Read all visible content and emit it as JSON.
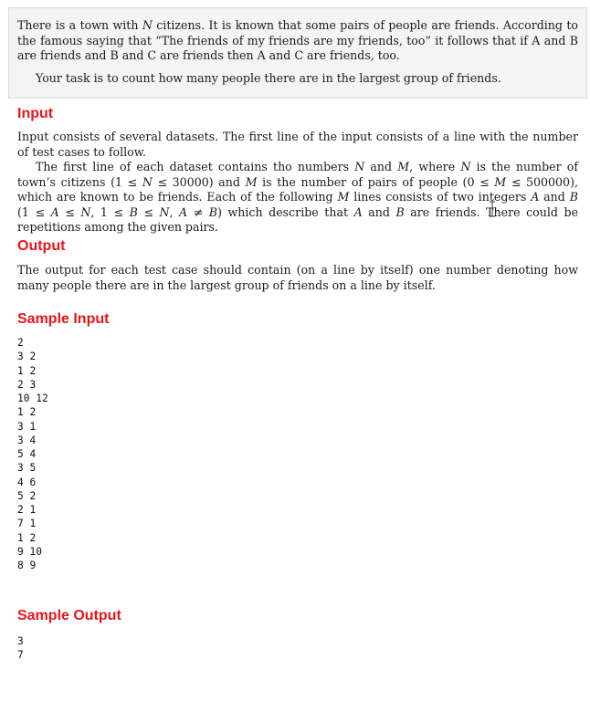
{
  "statement": {
    "p1": [
      "There is a town with ",
      "N",
      " citizens. It is known that some pairs of people are friends. According to the famous saying that “The friends of my friends are my friends, too” it follows that if A and B are friends and B and C are friends then A and C are friends, too."
    ],
    "p2": "Your task is to count how many people there are in the largest group of friends."
  },
  "input": {
    "heading": "Input",
    "p1": "Input consists of several datasets. The first line of the input consists of a line with the number of test cases to follow.",
    "p2": [
      "The first line of each dataset contains tho numbers ",
      "N",
      " and ",
      "M",
      ", where ",
      "N",
      " is the number of town’s citizens (1 ≤ ",
      "N",
      " ≤ 30000) and ",
      "M",
      " is the number of pairs of people (0 ≤ ",
      "M",
      " ≤ 500000), which are known to be friends. Each of the following ",
      "M",
      " lines consists of two integers ",
      "A",
      " and ",
      "B",
      " (1 ≤ ",
      "A",
      " ≤ ",
      "N",
      ", 1 ≤ ",
      "B",
      " ≤ ",
      "N",
      ", ",
      "A",
      " ≠ ",
      "B",
      ") which describe that ",
      "A",
      " and ",
      "B",
      " are friends. There could be repetitions among the given pairs."
    ]
  },
  "output": {
    "heading": "Output",
    "p1": "The output for each test case should contain (on a line by itself) one number denoting how many people there are in the largest group of friends on a line by itself."
  },
  "sample_input": {
    "heading": "Sample Input",
    "lines": [
      "2",
      "3 2",
      "1 2",
      "2 3",
      "10 12",
      "1 2",
      "3 1",
      "3 4",
      "5 4",
      "3 5",
      "4 6",
      "5 2",
      "2 1",
      "7 1",
      "1 2",
      "9 10",
      "8 9"
    ]
  },
  "sample_output": {
    "heading": "Sample Output",
    "lines": [
      "3",
      "7"
    ]
  }
}
